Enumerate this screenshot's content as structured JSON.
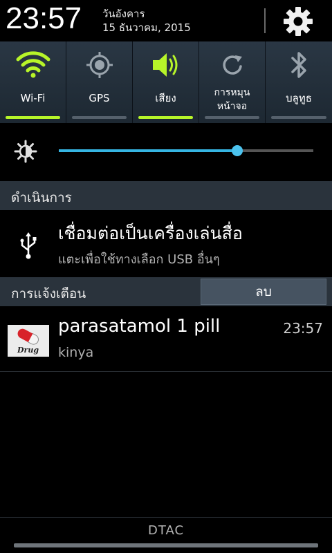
{
  "status_header": {
    "time": "23:57",
    "day": "วันอังคาร",
    "date": "15 ธันวาคม, 2015",
    "settings_icon": "gear-icon"
  },
  "quick_toggles": [
    {
      "label": "Wi-Fi",
      "icon": "wifi-icon",
      "active": true
    },
    {
      "label": "GPS",
      "icon": "gps-icon",
      "active": false
    },
    {
      "label": "เสียง",
      "icon": "sound-icon",
      "active": true
    },
    {
      "label_line1": "การหมุน",
      "label_line2": "หน้าจอ",
      "icon": "screen-rotation-icon",
      "active": false
    },
    {
      "label": "บลูทูธ",
      "icon": "bluetooth-icon",
      "active": false
    }
  ],
  "brightness": {
    "icon": "brightness-icon",
    "level": 0.7
  },
  "ongoing_section": {
    "title": "ดำเนินการ"
  },
  "ongoing_item": {
    "icon": "usb-icon",
    "title": "เชื่อมต่อเป็นเครื่องเล่นสื่อ",
    "subtitle": "แตะเพื่อใช้ทางเลือก USB อื่นๆ"
  },
  "notifications_section": {
    "title": "การแจ้งเตือน",
    "clear_label": "ลบ"
  },
  "notifications": [
    {
      "app_icon": "drug-capsule-icon",
      "icon_text": "Drug",
      "title": "parasatamol 1 pill",
      "subtitle": "kinya",
      "time": "23:57"
    }
  ],
  "footer": {
    "carrier": "DTAC"
  },
  "colors": {
    "accent_green": "#b7f529",
    "slider_blue": "#36b5e3"
  }
}
